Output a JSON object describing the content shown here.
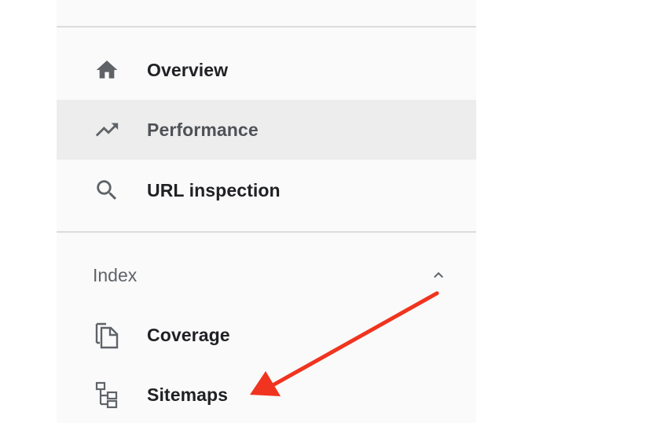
{
  "sidebar": {
    "items": [
      {
        "label": "Overview",
        "icon": "home-icon",
        "active": false
      },
      {
        "label": "Performance",
        "icon": "trending-up-icon",
        "active": true
      },
      {
        "label": "URL inspection",
        "icon": "search-icon",
        "active": false
      }
    ],
    "section": {
      "label": "Index",
      "icon": "chevron-up-icon",
      "expanded": true,
      "items": [
        {
          "label": "Coverage",
          "icon": "copy-pages-icon"
        },
        {
          "label": "Sitemaps",
          "icon": "sitemap-icon"
        }
      ]
    }
  },
  "annotation": {
    "icon": "red-arrow-icon",
    "color": "#f0341f",
    "target": "Sitemaps"
  },
  "colors": {
    "sidebar_background": "#fafafa",
    "active_background": "#ededed",
    "icon_color": "#5f6368",
    "label_color": "#202124"
  }
}
